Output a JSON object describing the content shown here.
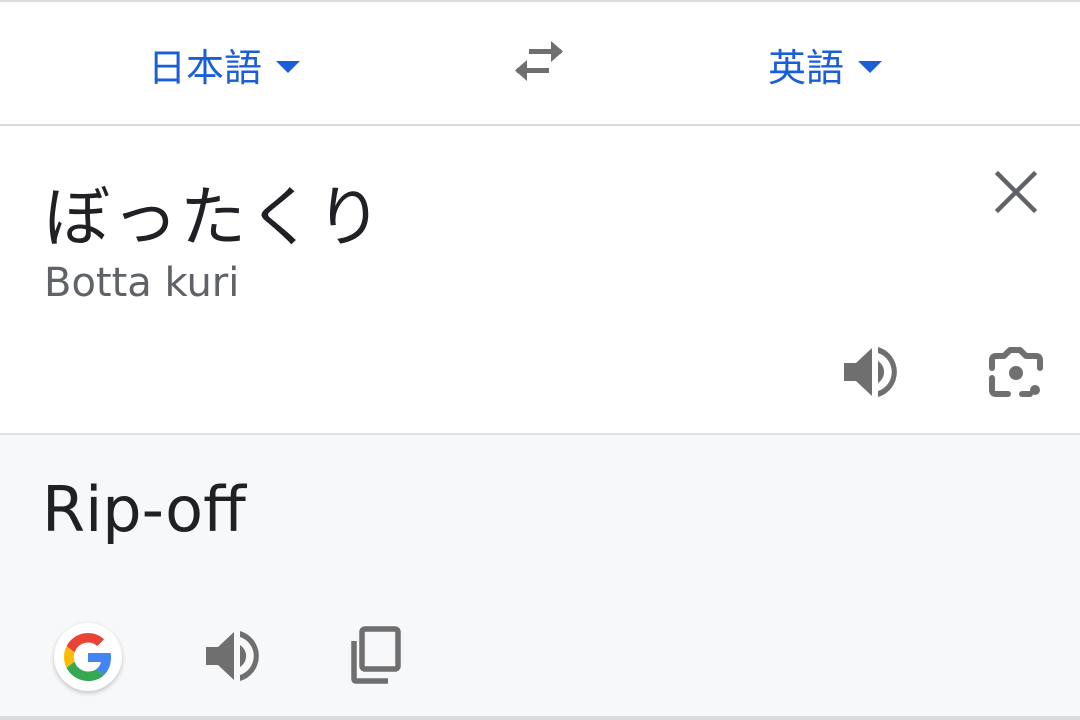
{
  "language_bar": {
    "source_language": "日本語",
    "target_language": "英語",
    "swap_icon": "swap-horiz-icon",
    "accent_color": "#1a5fd8"
  },
  "input": {
    "source_text": "ぼったくり",
    "romanization": "Botta kuri",
    "clear_icon": "close-icon",
    "speak_icon": "volume-icon",
    "camera_icon": "lens-camera-icon"
  },
  "output": {
    "translation": "Rip-off",
    "google_icon": "google-g-icon",
    "speak_icon": "volume-icon",
    "copy_icon": "copy-icon"
  }
}
